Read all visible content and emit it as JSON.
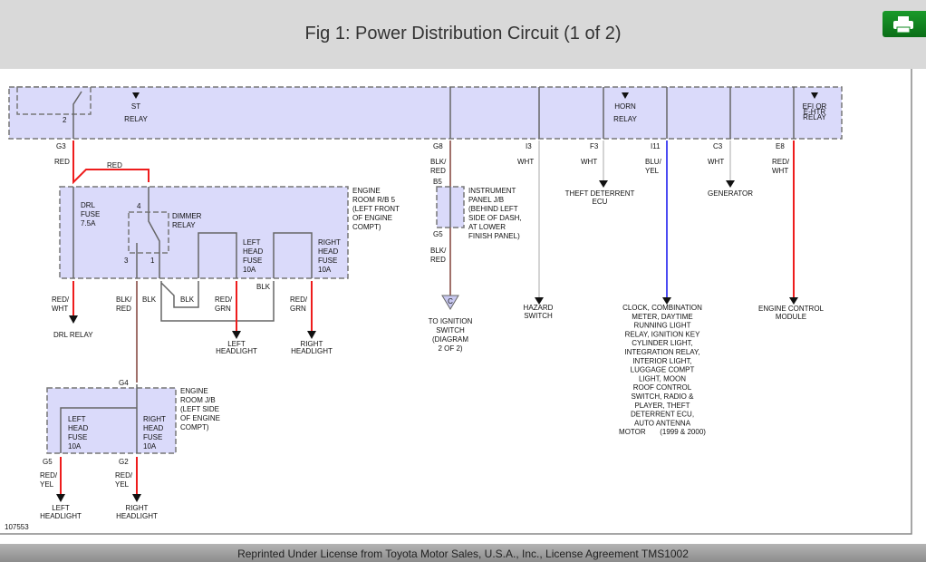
{
  "header": {
    "title": "Fig 1: Power Distribution Circuit (1 of 2)",
    "print_icon": "printer-icon",
    "print_color": "#0f8a1f"
  },
  "footer": {
    "text": "Reprinted Under License from Toyota Motor Sales, U.S.A., Inc., License Agreement TMS1002"
  },
  "diagram": {
    "figure_number": "107553",
    "top": {
      "st_relay": "ST\nRELAY",
      "horn_relay": "HORN\nRELAY",
      "efi_relay": "EFI OR\nE-HTR\nRELAY",
      "pin2": "2"
    },
    "left": {
      "g3": "G3",
      "red1": "RED",
      "red2": "RED",
      "drl_fuse": "DRL\nFUSE\n7.5A",
      "pin4": "4",
      "dimmer": "DIMMER\nRELAY",
      "pin3": "3",
      "pin1": "1",
      "lh_fuse": "LEFT\nHEAD\nFUSE\n10A",
      "rh_fuse": "RIGHT\nHEAD\nFUSE\n10A",
      "engine_rb5": "ENGINE\nROOM R/B 5\n(LEFT FRONT\nOF ENGINE\nCOMPT)",
      "red_wht": "RED/\nWHT",
      "drl_relay": "DRL RELAY",
      "blk_red": "BLK/\nRED",
      "blk1": "BLK",
      "blk2": "BLK",
      "blk3": "BLK",
      "red_grn1": "RED/\nGRN",
      "red_grn2": "RED/\nGRN",
      "left_headlight": "LEFT\nHEADLIGHT",
      "right_headlight": "RIGHT\nHEADLIGHT"
    },
    "lower": {
      "g4": "G4",
      "engine_jb": "ENGINE\nROOM J/B\n(LEFT SIDE\nOF ENGINE\nCOMPT)",
      "lh_fuse": "LEFT\nHEAD\nFUSE\n10A",
      "rh_fuse": "RIGHT\nHEAD\nFUSE\n10A",
      "g5": "G5",
      "g2": "G2",
      "red_yel1": "RED/\nYEL",
      "red_yel2": "RED/\nYEL",
      "left_headlight": "LEFT\nHEADLIGHT",
      "right_headlight": "RIGHT\nHEADLIGHT"
    },
    "right": {
      "g8": "G8",
      "blk_red1": "BLK/\nRED",
      "b5": "B5",
      "ipjb": "INSTRUMENT\nPANEL J/B\n(BEHIND LEFT\nSIDE OF DASH,\nAT LOWER\nFINISH PANEL)",
      "g5": "G5",
      "blk_red2": "BLK/\nRED",
      "c": "C",
      "to_ign": "TO IGNITION\nSWITCH\n(DIAGRAM\n2 OF 2)",
      "i3": "I3",
      "wht1": "WHT",
      "hazard": "HAZARD\nSWITCH",
      "f3": "F3",
      "wht2": "WHT",
      "theft": "THEFT DETERRENT\nECU",
      "i11": "I11",
      "blu_yel": "BLU/\nYEL",
      "clock": "CLOCK, COMBINATION\nMETER, DAYTIME\nRUNNING LIGHT\nRELAY, IGNITION KEY\nCYLINDER LIGHT,\nINTEGRATION RELAY,\nINTERIOR LIGHT,\nLUGGAGE COMPT\nLIGHT, MOON\nROOF CONTROL\nSWITCH, RADIO &\nPLAYER, THEFT\nDETERRENT ECU,\nAUTO ANTENNA\nMOTOR       (1999 & 2000)",
      "c3": "C3",
      "wht3": "WHT",
      "generator": "GENERATOR",
      "e8": "E8",
      "red_wht": "RED/\nWHT",
      "ecm": "ENGINE CONTROL\nMODULE"
    },
    "wire_colors": {
      "red": "#ee1c1c",
      "blue": "#1010ee",
      "white": "#d4d4d4",
      "blk_red": "#a0706a",
      "black": "#666666"
    }
  }
}
